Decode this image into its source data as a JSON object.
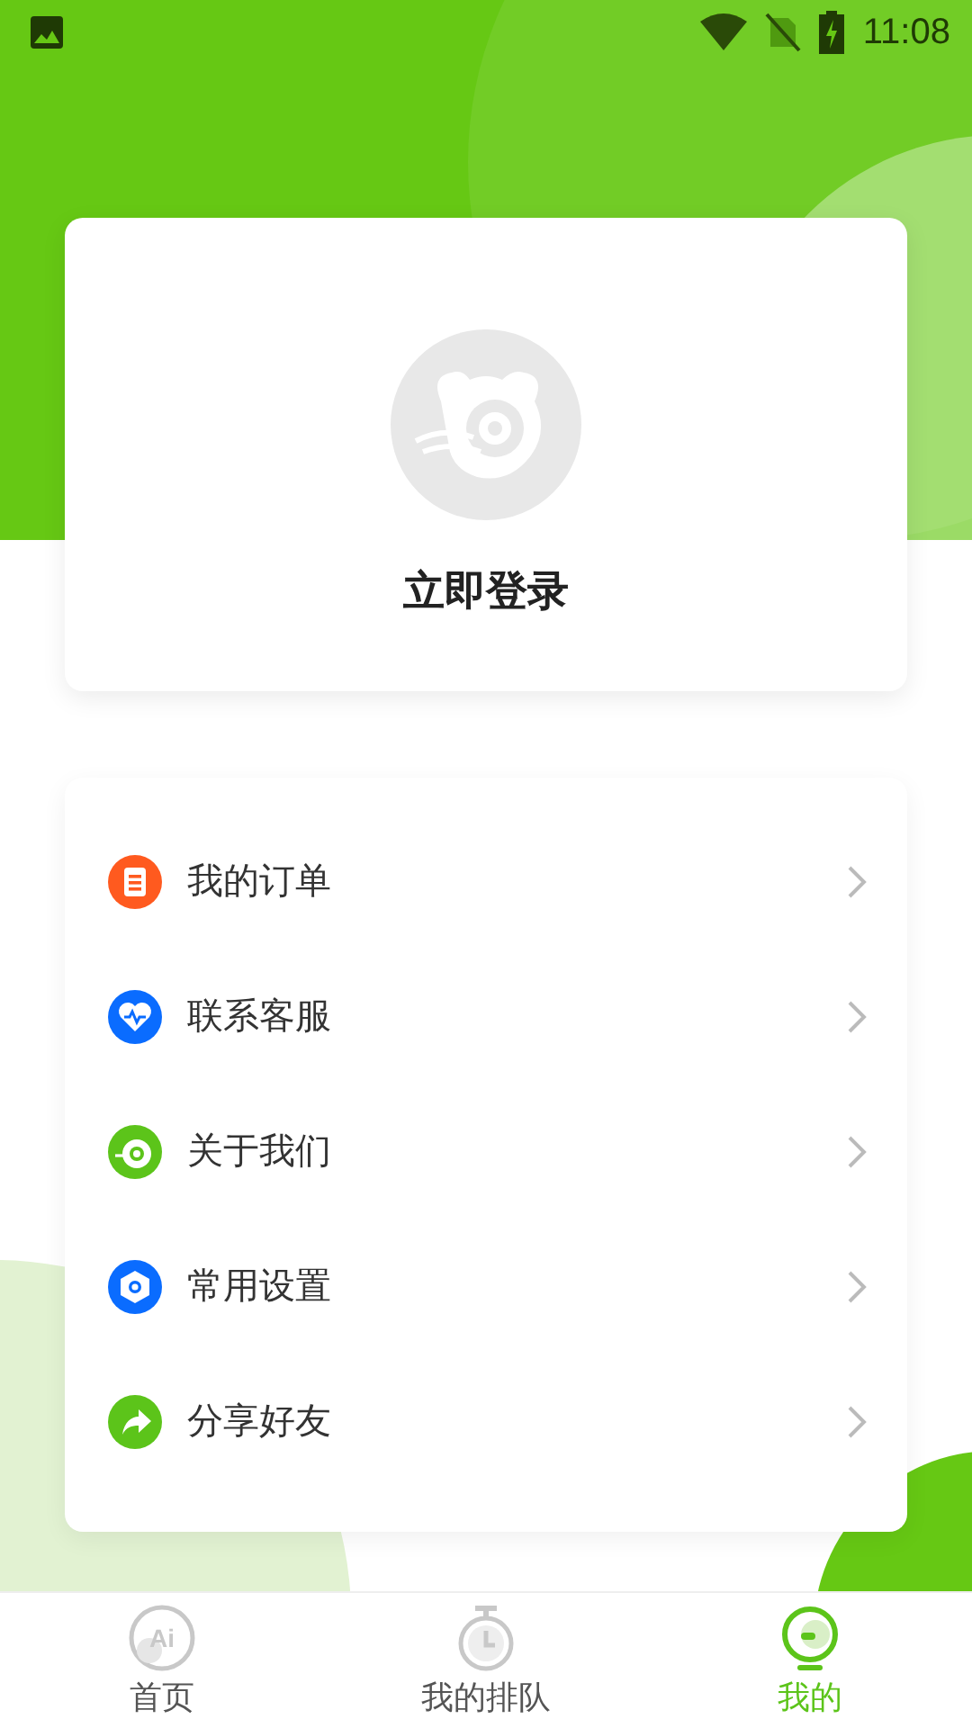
{
  "status_bar": {
    "time": "11:08"
  },
  "profile": {
    "login_label": "立即登录"
  },
  "menu": [
    {
      "kind": "order",
      "label": "我的订单",
      "color": "#ff5a1f"
    },
    {
      "kind": "service",
      "label": "联系客服",
      "color": "#0a6cff"
    },
    {
      "kind": "about",
      "label": "关于我们",
      "color": "#5cc41a"
    },
    {
      "kind": "settings",
      "label": "常用设置",
      "color": "#0a6cff"
    },
    {
      "kind": "share",
      "label": "分享好友",
      "color": "#5cc41a"
    }
  ],
  "tabs": [
    {
      "kind": "home",
      "label": "首页",
      "icon_text": "Ai",
      "selected": false
    },
    {
      "kind": "queue",
      "label": "我的排队",
      "selected": false
    },
    {
      "kind": "mine",
      "label": "我的",
      "selected": true
    }
  ]
}
